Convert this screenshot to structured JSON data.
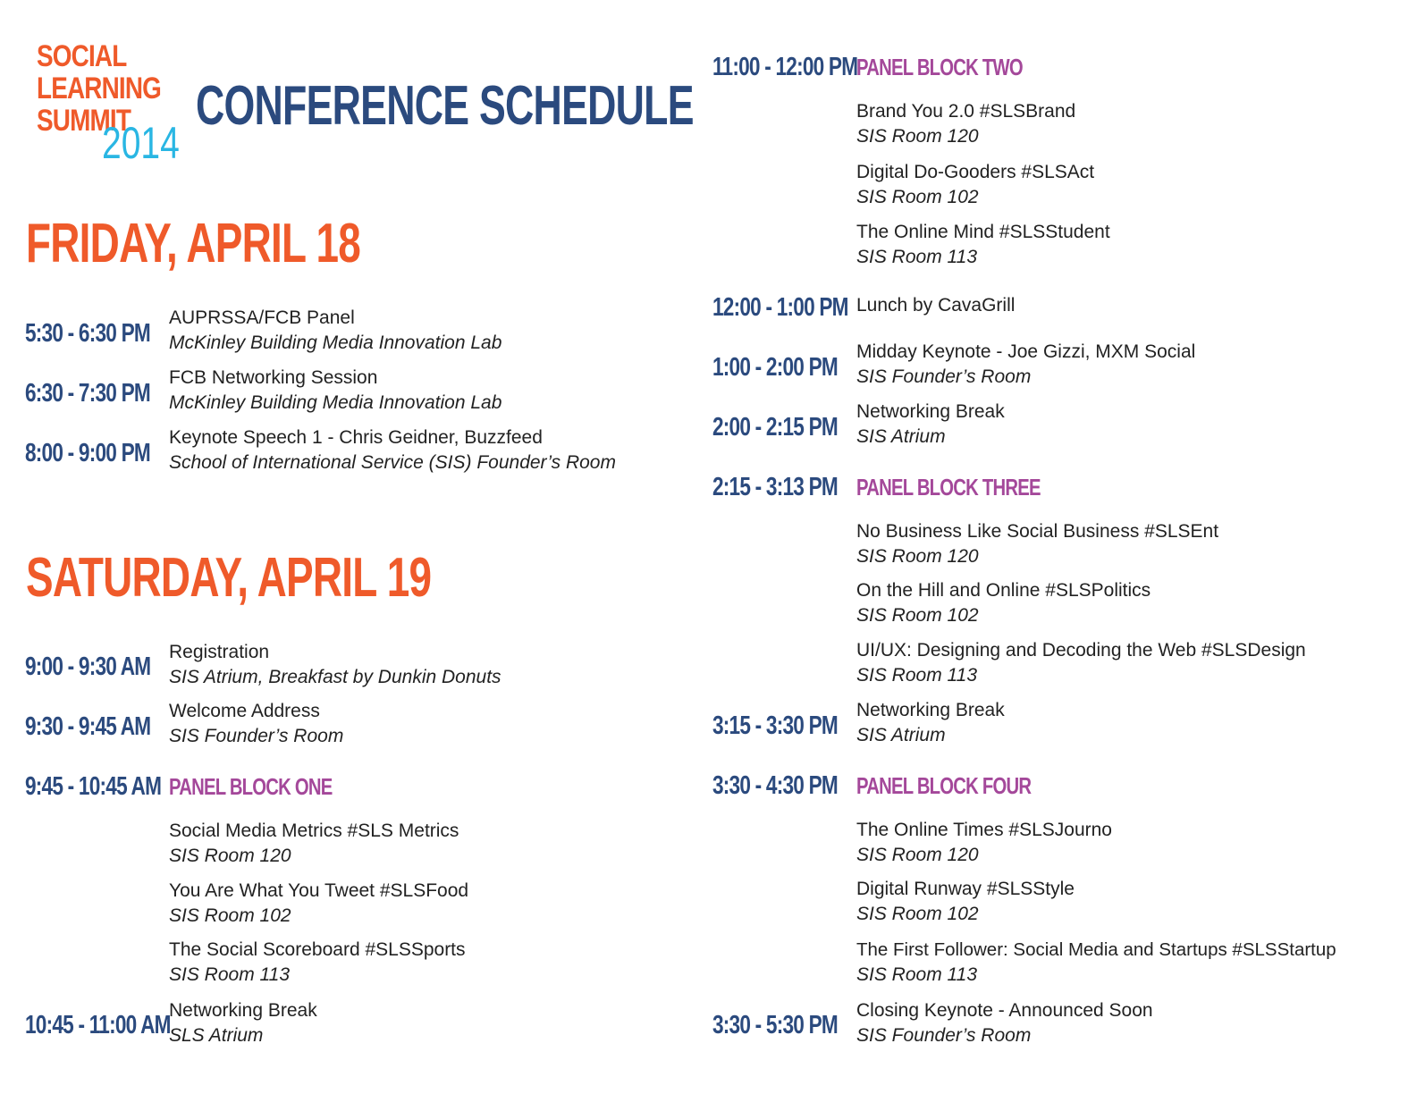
{
  "logo": {
    "line1": "SOCIAL",
    "line2": "LEARNING",
    "line3": "SUMMIT",
    "year": "2014"
  },
  "title": "CONFERENCE SCHEDULE",
  "colors": {
    "orange": "#ef5a2a",
    "navy": "#2b4a7e",
    "cyan": "#29b6e3",
    "purple": "#a4489a"
  },
  "friday": {
    "heading": "FRIDAY, APRIL 18",
    "events": [
      {
        "time": "5:30 - 6:30 PM",
        "title": "AUPRSSA/FCB Panel",
        "location": "McKinley Building Media Innovation Lab"
      },
      {
        "time": "6:30 - 7:30 PM",
        "title": "FCB Networking Session",
        "location": "McKinley Building Media Innovation Lab"
      },
      {
        "time": "8:00 - 9:00 PM",
        "title": "Keynote Speech 1 - Chris Geidner, Buzzfeed",
        "location": "School of International Service (SIS) Founder’s Room"
      }
    ]
  },
  "saturday": {
    "heading": "SATURDAY, APRIL 19",
    "events": [
      {
        "time": "9:00 - 9:30 AM",
        "title": "Registration",
        "location": "SIS Atrium, Breakfast by Dunkin Donuts"
      },
      {
        "time": "9:30 - 9:45 AM",
        "title": "Welcome Address",
        "location": "SIS Founder’s Room"
      },
      {
        "time": "9:45 - 10:45 AM",
        "panel": "PANEL BLOCK ONE",
        "sessions": [
          {
            "title": "Social Media Metrics #SLS Metrics",
            "location": "SIS Room 120"
          },
          {
            "title": "You Are What You Tweet #SLSFood",
            "location": "SIS Room 102"
          },
          {
            "title": "The Social Scoreboard #SLSSports",
            "location": "SIS Room 113"
          }
        ]
      },
      {
        "time": "10:45 - 11:00 AM",
        "title": "Networking Break",
        "location": "SLS Atrium"
      },
      {
        "time": "11:00 - 12:00 PM",
        "panel": "PANEL BLOCK TWO",
        "sessions": [
          {
            "title": "Brand You 2.0 #SLSBrand",
            "location": "SIS Room 120"
          },
          {
            "title": "Digital Do-Gooders #SLSAct",
            "location": "SIS Room 102"
          },
          {
            "title": "The Online Mind #SLSStudent",
            "location": "SIS Room 113"
          }
        ]
      },
      {
        "time": "12:00 - 1:00 PM",
        "title": "Lunch by CavaGrill"
      },
      {
        "time": "1:00 - 2:00 PM",
        "title": "Midday Keynote - Joe Gizzi, MXM Social",
        "location": "SIS Founder’s Room"
      },
      {
        "time": "2:00 - 2:15 PM",
        "title": "Networking Break",
        "location": "SIS Atrium"
      },
      {
        "time": "2:15 - 3:13 PM",
        "panel": "PANEL BLOCK THREE",
        "sessions": [
          {
            "title": "No Business Like Social Business #SLSEnt",
            "location": "SIS Room 120"
          },
          {
            "title": "On the Hill and Online #SLSPolitics",
            "location": "SIS Room 102"
          },
          {
            "title": "UI/UX: Designing and Decoding the Web #SLSDesign",
            "location": "SIS Room 113"
          }
        ]
      },
      {
        "time": "3:15 - 3:30 PM",
        "title": "Networking Break",
        "location": "SIS Atrium"
      },
      {
        "time": "3:30 - 4:30 PM",
        "panel": "PANEL BLOCK FOUR",
        "sessions": [
          {
            "title": "The Online Times #SLSJourno",
            "location": "SIS Room 120"
          },
          {
            "title": "Digital Runway #SLSStyle",
            "location": "SIS Room 102"
          },
          {
            "title": "The First Follower: Social Media and Startups #SLSStartup",
            "location": "SIS Room 113"
          }
        ]
      },
      {
        "time": "3:30 - 5:30 PM",
        "title": "Closing Keynote - Announced Soon",
        "location": "SIS Founder’s Room"
      }
    ]
  }
}
